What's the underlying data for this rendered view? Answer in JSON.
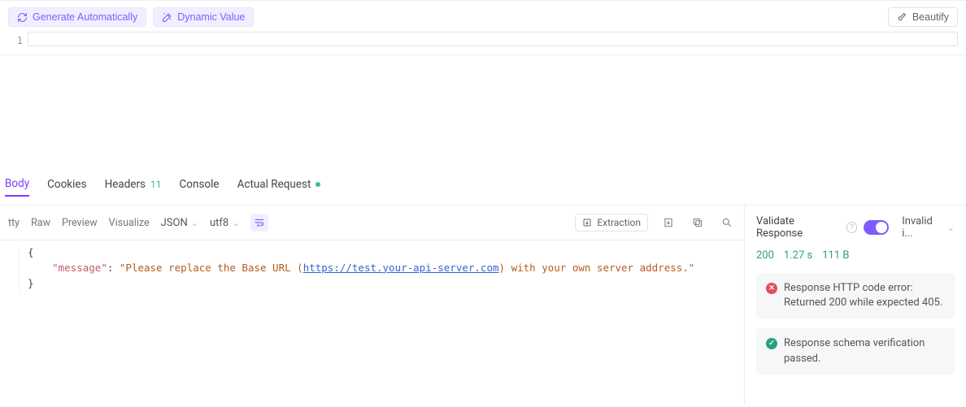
{
  "toolbar": {
    "generate_label": "Generate Automatically",
    "dynamic_label": "Dynamic Value",
    "beautify_label": "Beautify"
  },
  "editor": {
    "line_numbers": [
      "1"
    ]
  },
  "tabs": {
    "body": "Body",
    "cookies": "Cookies",
    "headers": "Headers",
    "headers_count": "11",
    "console": "Console",
    "actual_request": "Actual Request"
  },
  "subtabs": {
    "format_left": "tty",
    "raw": "Raw",
    "preview": "Preview",
    "visualize": "Visualize",
    "format_select": "JSON",
    "encoding_select": "utf8",
    "extraction_label": "Extraction"
  },
  "response_body": {
    "open_brace": "{",
    "key": "\"message\"",
    "colon": ": ",
    "value_pre": "\"Please replace the Base URL (",
    "url": "https://test.your-api-server.com",
    "value_post": ") with your own server address.\"",
    "close_brace": "}"
  },
  "validate": {
    "label": "Validate Response",
    "invalid_label": "Invalid i..."
  },
  "stats": {
    "code": "200",
    "time": "1.27 s",
    "size": "111 B"
  },
  "messages": {
    "error": "Response HTTP code error: Returned 200 while expected 405.",
    "ok": "Response schema verification passed."
  }
}
